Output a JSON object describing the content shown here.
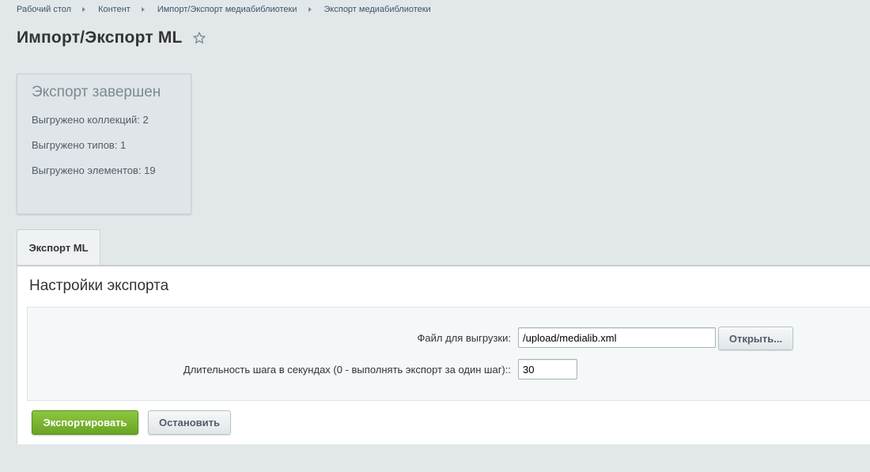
{
  "breadcrumb": {
    "items": [
      "Рабочий стол",
      "Контент",
      "Импорт/Экспорт медиабиблиотеки",
      "Экспорт медиабиблиотеки"
    ]
  },
  "page": {
    "title": "Импорт/Экспорт ML",
    "favorite_icon": "star-outline-icon"
  },
  "result": {
    "title": "Экспорт завершен",
    "collections": "Выгружено коллекций: 2",
    "types": "Выгружено типов: 1",
    "elements": "Выгружено элементов: 19"
  },
  "tabs": [
    {
      "label": "Экспорт ML",
      "active": true
    }
  ],
  "settings": {
    "title": "Настройки экспорта",
    "file_label": "Файл для выгрузки:",
    "file_value": "/upload/medialib.xml",
    "open_button": "Открыть...",
    "step_label": "Длительность шага в секундах (0 - выполнять экспорт за один шаг)::",
    "step_value": "30"
  },
  "actions": {
    "export_button": "Экспортировать",
    "stop_button": "Остановить"
  },
  "colors": {
    "background": "#e2e8ea",
    "primary_button": "#7bb531",
    "panel": "#ffffff"
  }
}
